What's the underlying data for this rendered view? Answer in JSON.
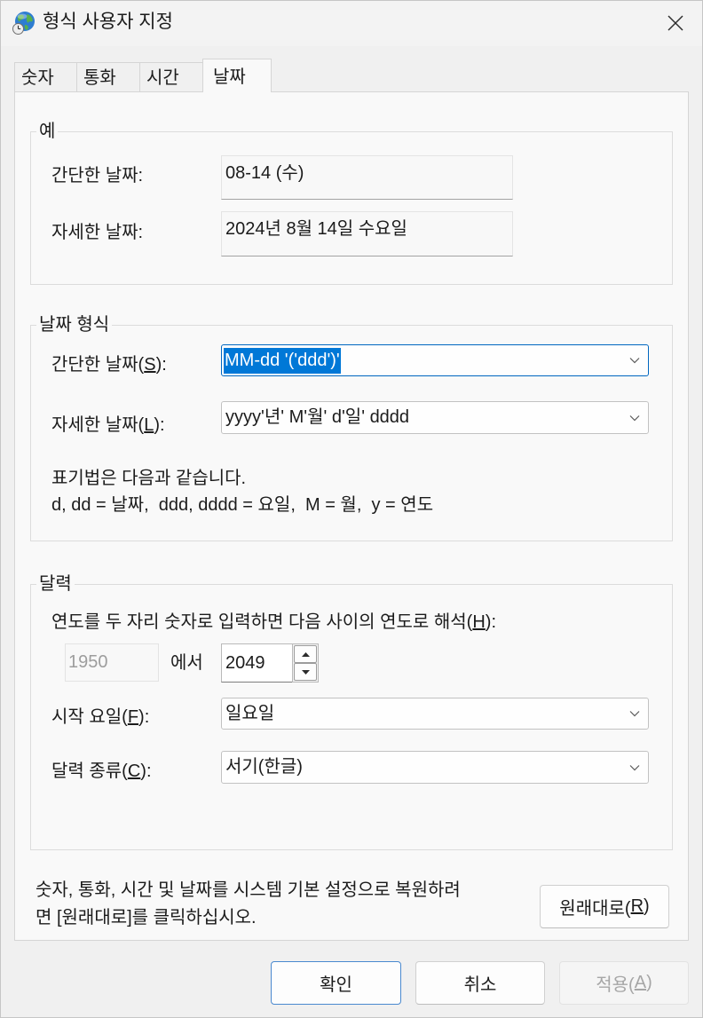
{
  "window": {
    "title": "형식 사용자 지정",
    "icon": "globe-icon",
    "close_icon": "close-icon"
  },
  "tabs": [
    {
      "label": "숫자",
      "selected": false
    },
    {
      "label": "통화",
      "selected": false
    },
    {
      "label": "시간",
      "selected": false
    },
    {
      "label": "날짜",
      "selected": true
    }
  ],
  "example": {
    "legend": "예",
    "short_label": "간단한 날짜:",
    "short_value": "08-14 (수)",
    "long_label": "자세한 날짜:",
    "long_value": "2024년 8월 14일 수요일"
  },
  "date_format": {
    "legend": "날짜 형식",
    "short": {
      "label_prefix": "간단한 날짜(",
      "label_key": "S",
      "label_suffix": "):",
      "value": "MM-dd '('ddd')'",
      "value_selected": true
    },
    "long": {
      "label_prefix": "자세한 날짜(",
      "label_key": "L",
      "label_suffix": "):",
      "value": "yyyy'년' M'월' d'일' dddd"
    },
    "notation_title": "표기법은 다음과 같습니다.",
    "notation": "d, dd = 날짜,  ddd, dddd = 요일,  M = 월,  y = 연도"
  },
  "calendar": {
    "legend": "달력",
    "two_digit_year": {
      "label_prefix": "연도를 두 자리 숫자로 입력하면 다음 사이의 연도로 해석(",
      "label_key": "H",
      "label_suffix": "):",
      "from": "1950",
      "from_disabled": true,
      "between": "에서",
      "to": "2049"
    },
    "first_day": {
      "label_prefix": "시작 요일(",
      "label_key": "F",
      "label_suffix": "):",
      "value": "일요일"
    },
    "calendar_type": {
      "label_prefix": "달력 종류(",
      "label_key": "C",
      "label_suffix": "):",
      "value": "서기(한글)"
    }
  },
  "reset": {
    "text_line1": "숫자, 통화, 시간 및 날짜를 시스템 기본 설정으로 복원하려",
    "text_line2": "면 [원래대로]를 클릭하십시오.",
    "button_prefix": "원래대로(",
    "button_key": "R",
    "button_suffix": ")"
  },
  "buttons": {
    "ok": "확인",
    "cancel": "취소",
    "apply_prefix": "적용(",
    "apply_key": "A",
    "apply_suffix": ")",
    "apply_disabled": true
  },
  "icons": {
    "dropdown": "chevron-down-icon",
    "spin_up": "triangle-up-icon",
    "spin_down": "triangle-down-icon"
  },
  "colors": {
    "accent": "#0067c0",
    "selection": "#0078d7",
    "disabled_text": "#a6a6a6"
  }
}
